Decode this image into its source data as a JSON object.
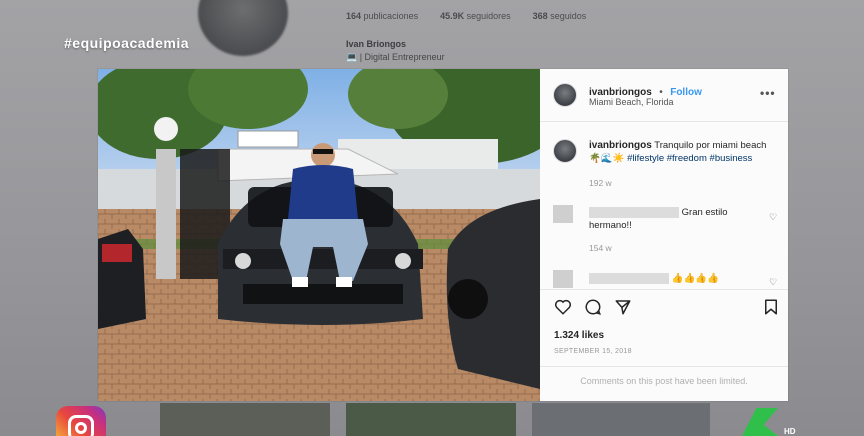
{
  "overlay": {
    "hashtag": "#equipoacademia"
  },
  "background_profile": {
    "stats": [
      {
        "value": "164",
        "label": "publicaciones"
      },
      {
        "value": "45.9K",
        "label": "seguidores"
      },
      {
        "value": "368",
        "label": "seguidos"
      }
    ],
    "name": "Ivan Briongos",
    "bio": "💻 | Digital Entrepreneur"
  },
  "post": {
    "username": "ivanbriongos",
    "follow_label": "Follow",
    "separator": "•",
    "location": "Miami Beach, Florida",
    "more_label": "•••",
    "caption": {
      "username": "ivanbriongos",
      "text": "Tranquilo por miami beach",
      "emojis": "🌴🌊☀️",
      "hashtags": [
        "#lifestyle",
        "#freedom",
        "#business"
      ],
      "time": "192 w"
    },
    "comments": [
      {
        "text": "Gran estilo hermano!!",
        "time": "154 w"
      },
      {
        "text": "👍👍👍👍",
        "time": ""
      }
    ],
    "likes": "1.324 likes",
    "date": "SEPTEMBER 15, 2018",
    "limited_notice": "Comments on this post have been limited."
  },
  "branding": {
    "hd_label": "HD"
  },
  "colors": {
    "link": "#3897f0",
    "hashtag": "#003569",
    "muted": "#999999"
  }
}
